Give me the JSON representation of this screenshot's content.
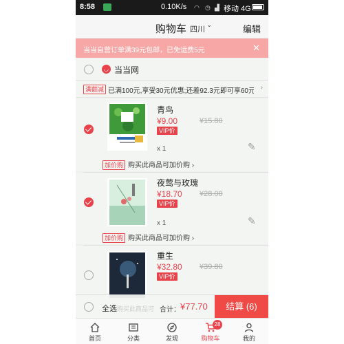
{
  "status_bar": {
    "time": "8:58",
    "net_speed": "0.10K/s",
    "carrier": "移动 4G"
  },
  "header": {
    "title": "购物车",
    "region": "四川",
    "edit_label": "编辑"
  },
  "promo_banner": {
    "text": "当当自营订单满39元包邮，已免运费5元",
    "close_icon": "close-icon"
  },
  "shop": {
    "name": "当当网",
    "selected": false
  },
  "discount": {
    "tag": "满额减",
    "text": "已满100元,享受30元优惠;还差92.3元即可享60元优惠,去"
  },
  "items": [
    {
      "title": "青鸟",
      "price": "¥9.00",
      "original_price": "¥15.80",
      "vip_label": "VIP价",
      "quantity": "x 1",
      "selected": true,
      "addon_tag": "加价购",
      "addon_text": "购买此商品可加价购",
      "cover_color": "#3f9a3a"
    },
    {
      "title": "夜莺与玫瑰",
      "price": "¥18.70",
      "original_price": "¥28.00",
      "vip_label": "VIP价",
      "quantity": "x 1",
      "selected": true,
      "addon_tag": "加价购",
      "addon_text": "购买此商品可加价购",
      "cover_color": "#a7d4b8"
    },
    {
      "title": "重生",
      "price": "¥32.80",
      "original_price": "¥39.80",
      "vip_label": "VIP价",
      "quantity": "",
      "selected": false,
      "addon_tag": "",
      "addon_text": "",
      "cover_color": "#1d2838"
    }
  ],
  "checkout": {
    "select_all_label": "全选",
    "behind_text": "购买此商品可",
    "total_label": "合计：",
    "total": "¥77.70",
    "button_label": "结算 (6)"
  },
  "tabs": [
    {
      "label": "首页",
      "icon": "home-icon"
    },
    {
      "label": "分类",
      "icon": "category-icon"
    },
    {
      "label": "发现",
      "icon": "compass-icon"
    },
    {
      "label": "购物车",
      "icon": "cart-icon",
      "active": true,
      "badge": "28"
    },
    {
      "label": "我的",
      "icon": "user-icon"
    }
  ],
  "colors": {
    "accent": "#e8424b",
    "promo_bg": "#f7a8a6",
    "background": "#eef0ee"
  }
}
